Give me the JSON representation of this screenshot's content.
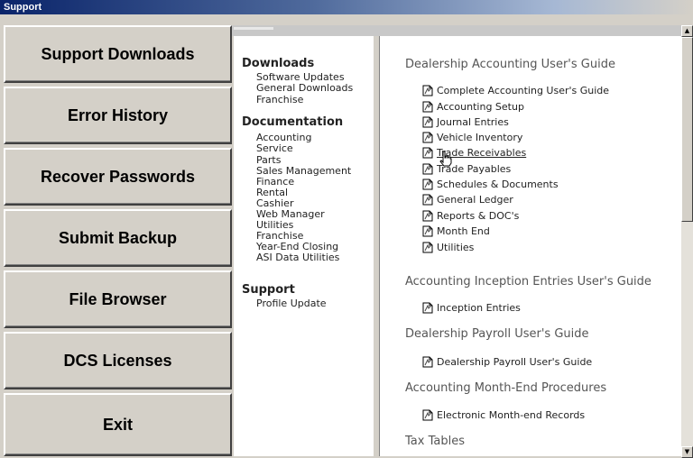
{
  "window": {
    "title": "Support"
  },
  "nav_buttons": [
    "Support Downloads",
    "Error History",
    "Recover Passwords",
    "Submit Backup",
    "File Browser",
    "DCS Licenses",
    "Exit"
  ],
  "link_panel": {
    "downloads": {
      "heading": "Downloads",
      "items": [
        "Software Updates",
        "General Downloads",
        "Franchise"
      ]
    },
    "documentation": {
      "heading": "Documentation",
      "items": [
        "Accounting",
        "Service",
        "Parts",
        "Sales Management",
        "Finance",
        "Rental",
        "Cashier",
        "Web Manager",
        "Utilities",
        "Franchise",
        "Year-End Closing",
        "ASI Data Utilities"
      ]
    },
    "support": {
      "heading": "Support",
      "items": [
        "Profile Update"
      ]
    }
  },
  "content": {
    "guides": [
      {
        "title": "Dealership Accounting User's Guide",
        "docs": [
          "Complete Accounting User's Guide",
          "Accounting Setup",
          "Journal Entries",
          "Vehicle Inventory",
          "Trade Receivables",
          "Trade Payables",
          "Schedules & Documents",
          "General Ledger",
          "Reports & DOC's",
          "Month End",
          "Utilities"
        ]
      },
      {
        "title": "Accounting Inception Entries User's Guide",
        "docs": [
          "Inception Entries"
        ]
      },
      {
        "title": "Dealership Payroll User's Guide",
        "docs": [
          "Dealership Payroll User's Guide"
        ]
      },
      {
        "title": "Accounting Month-End Procedures",
        "docs": [
          "Electronic Month-end Records"
        ]
      },
      {
        "title": "Tax Tables",
        "docs": []
      }
    ],
    "hovered_doc": "Trade Receivables"
  },
  "icons": {
    "doc": "pdf-document-icon",
    "cursor": "hand-pointer-icon"
  }
}
